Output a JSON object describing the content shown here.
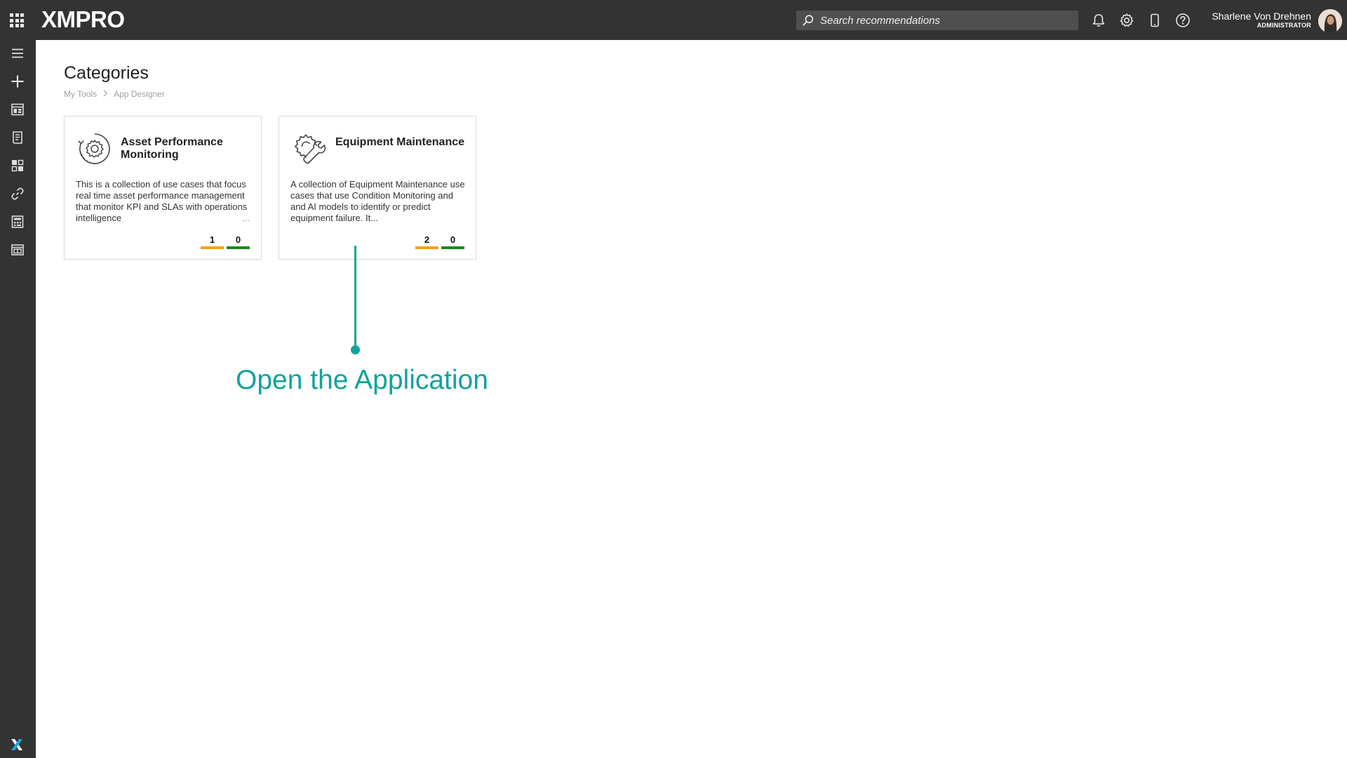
{
  "header": {
    "logo_text": "XMPRO",
    "search_placeholder": "Search recommendations",
    "user_name": "Sharlene Von Drehnen",
    "user_role": "ADMINISTRATOR",
    "icons": [
      "apps-grid-icon",
      "bell-icon",
      "gear-icon",
      "mobile-icon",
      "help-icon"
    ]
  },
  "sidebar": {
    "items": [
      "menu-icon",
      "add-icon",
      "dashboard-icon",
      "document-icon",
      "widgets-icon",
      "link-icon",
      "calculator-icon",
      "layout-icon"
    ],
    "footer_logo": "x-logo-icon"
  },
  "page": {
    "title": "Categories",
    "breadcrumb": [
      {
        "label": "My Tools"
      },
      {
        "label": "App Designer"
      }
    ]
  },
  "cards": [
    {
      "icon": "gear-cycle-icon",
      "title": "Asset Performance Monitoring",
      "description": "This is a collection of use cases that focus real time asset performance management that monitor KPI and SLAs with operations intelligence",
      "more": "...",
      "counts": [
        {
          "value": "1",
          "color": "#f5a01a"
        },
        {
          "value": "0",
          "color": "#1a8a1a"
        }
      ]
    },
    {
      "icon": "gear-wrench-icon",
      "title": "Equipment Maintenance",
      "description": "A collection of Equipment Maintenance use cases that use Condition Monitoring and and AI models to identify or predict equipment failure. It...",
      "more": "",
      "counts": [
        {
          "value": "2",
          "color": "#f5a01a"
        },
        {
          "value": "0",
          "color": "#1a8a1a"
        }
      ]
    }
  ],
  "annotation": {
    "text": "Open the Application",
    "color": "#12a39a"
  },
  "colors": {
    "topbar": "#333333",
    "accent_blue": "#1ba9e1",
    "orange": "#f5a01a",
    "green": "#1a8a1a"
  }
}
